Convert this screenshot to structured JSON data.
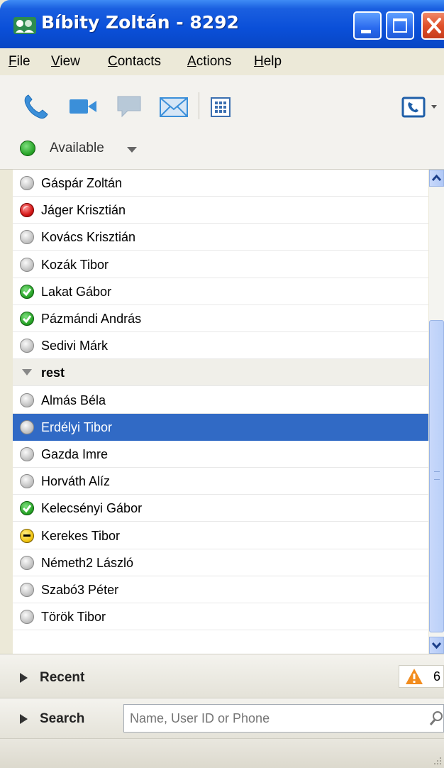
{
  "window": {
    "title": "Bíbity Zoltán - 8292"
  },
  "menu": {
    "items": [
      {
        "label": "File",
        "accel": "F",
        "rest": "ile"
      },
      {
        "label": "View",
        "accel": "V",
        "rest": "iew"
      },
      {
        "label": "Contacts",
        "accel": "C",
        "rest": "ontacts"
      },
      {
        "label": "Actions",
        "accel": "A",
        "rest": "ctions"
      },
      {
        "label": "Help",
        "accel": "H",
        "rest": "elp"
      }
    ]
  },
  "toolbar": {
    "icons": [
      "phone-icon",
      "video-icon",
      "chat-icon",
      "email-icon",
      "dialpad-icon",
      "call-mode-icon"
    ]
  },
  "presence": {
    "label": "Available"
  },
  "contacts": {
    "rows": [
      {
        "name": "Gáspár Zoltán",
        "status": "offline"
      },
      {
        "name": "Jáger Krisztián",
        "status": "busy"
      },
      {
        "name": "Kovács Krisztián",
        "status": "offline"
      },
      {
        "name": "Kozák Tibor",
        "status": "offline"
      },
      {
        "name": "Lakat Gábor",
        "status": "available"
      },
      {
        "name": "Pázmándi András",
        "status": "available"
      },
      {
        "name": "Sedivi Márk",
        "status": "offline"
      },
      {
        "name": "rest",
        "status": "group"
      },
      {
        "name": "Almás Béla",
        "status": "offline"
      },
      {
        "name": "Erdélyi Tibor",
        "status": "offline",
        "selected": true
      },
      {
        "name": "Gazda Imre",
        "status": "offline"
      },
      {
        "name": "Horváth Alíz",
        "status": "offline"
      },
      {
        "name": "Kelecsényi Gábor",
        "status": "available"
      },
      {
        "name": "Kerekes Tibor",
        "status": "away"
      },
      {
        "name": "Németh2 László",
        "status": "offline"
      },
      {
        "name": "Szabó3 Péter",
        "status": "offline"
      },
      {
        "name": "Török Tibor",
        "status": "offline"
      }
    ]
  },
  "recent": {
    "label": "Recent",
    "count": "6"
  },
  "search": {
    "label": "Search",
    "placeholder": "Name, User ID or Phone"
  }
}
